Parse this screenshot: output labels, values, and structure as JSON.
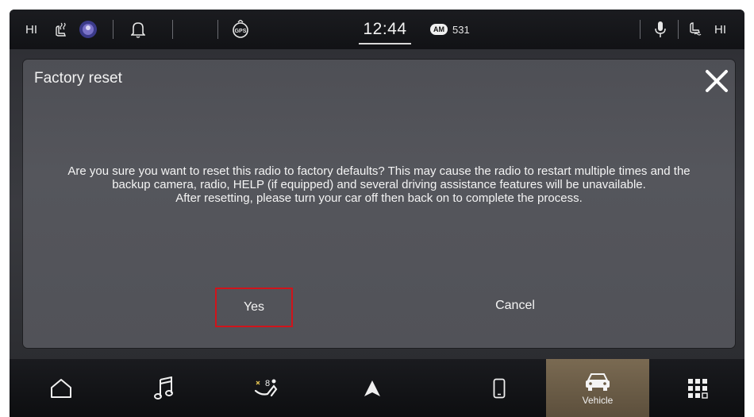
{
  "status_bar": {
    "left_climate_level": "HI",
    "right_climate_level": "HI",
    "clock": "12:44",
    "radio_band": "AM",
    "radio_frequency": "531",
    "gps_label": "GPS",
    "icons": [
      "heated-seat-icon",
      "driver-profile-icon",
      "bell-icon",
      "gps-icon",
      "microphone-icon",
      "heated-seat-right-icon"
    ]
  },
  "dialog": {
    "title": "Factory reset",
    "message_line1": "Are you sure you want to reset this radio to factory defaults? This may cause the radio to restart multiple times and the backup camera, radio, HELP (if equipped) and several driving assistance features will be unavailable.",
    "message_line2": "After resetting, please turn your car off then back on to complete the process.",
    "yes_label": "Yes",
    "cancel_label": "Cancel",
    "highlight_color": "#d0141b"
  },
  "nav": {
    "items": [
      {
        "icon": "home-icon",
        "label": ""
      },
      {
        "icon": "music-icon",
        "label": ""
      },
      {
        "icon": "climate-icon",
        "label": "8"
      },
      {
        "icon": "navigation-icon",
        "label": ""
      },
      {
        "icon": "phone-icon",
        "label": ""
      },
      {
        "icon": "vehicle-icon",
        "label": "Vehicle"
      },
      {
        "icon": "apps-grid-icon",
        "label": ""
      }
    ],
    "active_index": 5,
    "active_color": "#7a6a52"
  }
}
